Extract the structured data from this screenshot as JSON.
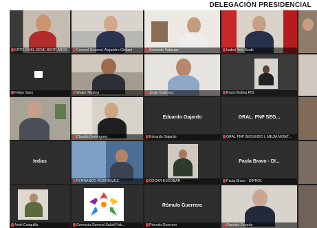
{
  "header": {
    "title": "DELEGACIÓN PRESIDENCIAL"
  },
  "participants": [
    {
      "caption": "ERTO EMEL DENE BERR ARCA"
    },
    {
      "caption": "Coronel General, Alejandro Gildiani"
    },
    {
      "caption": "Armando Salazzar"
    },
    {
      "caption": "Isabel Yela Seaki"
    },
    {
      "caption": "Felipe Saez"
    },
    {
      "caption": "Walter Medina"
    },
    {
      "caption": "Jorge Gutierrez"
    },
    {
      "caption": "Rocío Molina PDI"
    },
    {
      "caption": "Claudia Domínguez"
    },
    {
      "caption": "Eduardo Gajardo",
      "display": "Eduardo Gajardo"
    },
    {
      "caption": "GRAL PNP SEGUNDO L MEJIA MONT...",
      "display": "GRAL. PNP SEG..."
    },
    {
      "caption": "FERNANDO RODRIGUEZ"
    },
    {
      "caption": "OSCAR ESCOBAR"
    },
    {
      "caption": "Paula Bravo - DIPROL",
      "display": "Paula Bravo - DI..."
    },
    {
      "caption": "Aniel Cosquilla"
    },
    {
      "caption": "Gerencia General Salud Pub..."
    },
    {
      "caption": "Rómulo Guerrero",
      "display": "Rómulo Guerrero"
    },
    {
      "caption": "Gonzalo Zepeda"
    },
    {
      "caption": "",
      "display": "Iedias"
    }
  ],
  "colors": {
    "mic_muted": "#e53935",
    "tile_bg": "#2e2e2e"
  }
}
